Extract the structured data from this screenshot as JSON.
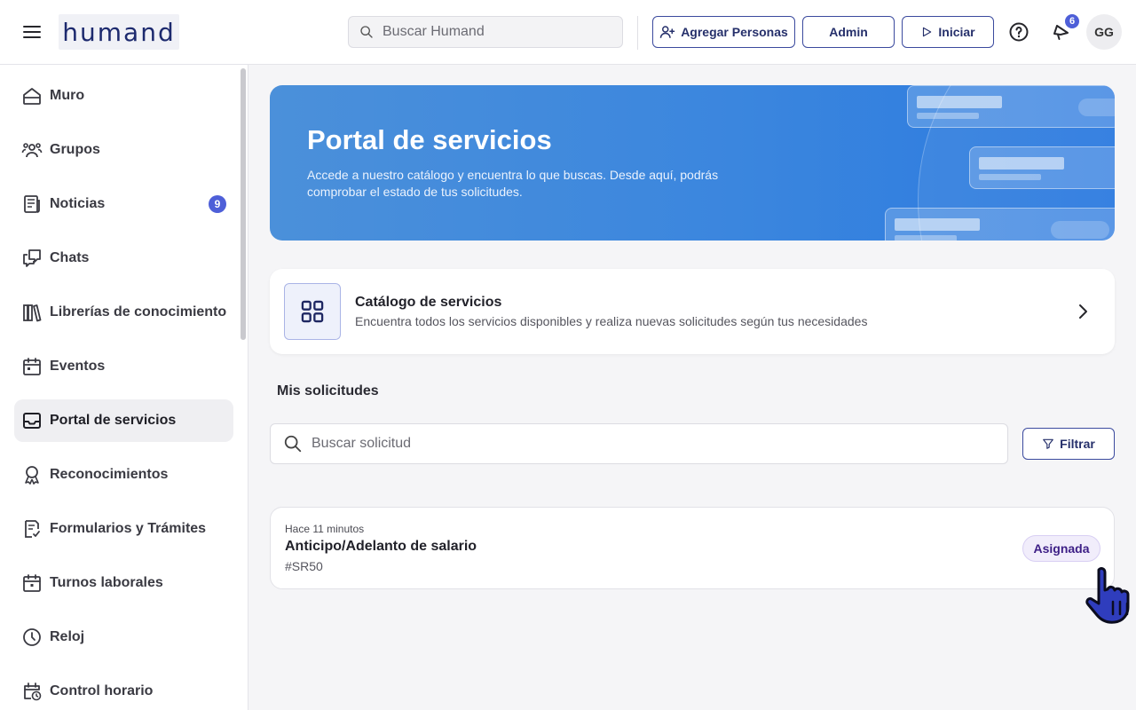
{
  "header": {
    "logo": "humand",
    "search_placeholder": "Buscar Humand",
    "add_people_label": "Agregar Personas",
    "admin_label": "Admin",
    "start_label": "Iniciar",
    "notifications_count": "6",
    "avatar_initials": "GG"
  },
  "sidebar": {
    "items": [
      {
        "label": "Muro",
        "icon": "home-icon"
      },
      {
        "label": "Grupos",
        "icon": "people-icon"
      },
      {
        "label": "Noticias",
        "icon": "newspaper-icon",
        "badge": "9"
      },
      {
        "label": "Chats",
        "icon": "chat-icon"
      },
      {
        "label": "Librerías de conocimiento",
        "icon": "library-icon"
      },
      {
        "label": "Eventos",
        "icon": "calendar-icon"
      },
      {
        "label": "Portal de servicios",
        "icon": "inbox-icon",
        "active": true
      },
      {
        "label": "Reconocimientos",
        "icon": "award-icon"
      },
      {
        "label": "Formularios y Trámites",
        "icon": "form-icon"
      },
      {
        "label": "Turnos laborales",
        "icon": "calendar-icon"
      },
      {
        "label": "Reloj",
        "icon": "clock-icon"
      },
      {
        "label": "Control horario",
        "icon": "calendar-clock-icon"
      }
    ]
  },
  "banner": {
    "title": "Portal de servicios",
    "description": "Accede a nuestro catálogo y encuentra lo que buscas. Desde aquí, podrás comprobar el estado de tus solicitudes."
  },
  "catalog": {
    "title": "Catálogo de servicios",
    "description": "Encuentra todos los servicios disponibles y realiza nuevas solicitudes según tus necesidades"
  },
  "requests": {
    "section_title": "Mis solicitudes",
    "search_placeholder": "Buscar solicitud",
    "filter_label": "Filtrar",
    "items": [
      {
        "time": "Hace 11 minutos",
        "title": "Anticipo/Adelanto de salario",
        "id": "#SR50",
        "status": "Asignada"
      }
    ]
  },
  "colors": {
    "accent": "#4e5fd8",
    "banner": "#3b86de",
    "status_bg": "#f1edfb",
    "status_text": "#3d1f86"
  }
}
